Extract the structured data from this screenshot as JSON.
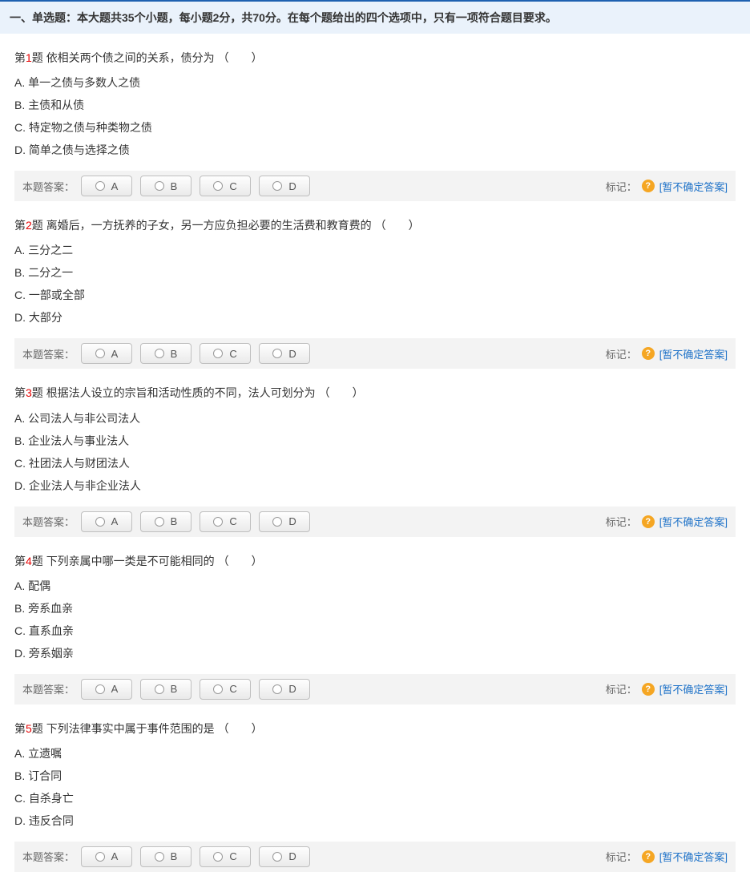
{
  "section_header": "一、单选题：本大题共35个小题，每小题2分，共70分。在每个题给出的四个选项中，只有一项符合题目要求。",
  "answer_label": "本题答案：",
  "mark_label": "标记：",
  "unsure_text": "[暂不确定答案]",
  "choices": [
    "A",
    "B",
    "C",
    "D"
  ],
  "questions": [
    {
      "num": "1",
      "prefix": "第",
      "suffix": "题",
      "stem": "依相关两个债之间的关系，债分为 （　　）",
      "options": [
        "A. 单一之债与多数人之债",
        "B. 主债和从债",
        "C. 特定物之债与种类物之债",
        "D. 简单之债与选择之债"
      ]
    },
    {
      "num": "2",
      "prefix": "第",
      "suffix": "题",
      "stem": "离婚后，一方抚养的子女，另一方应负担必要的生活费和教育费的 （　　）",
      "options": [
        "A. 三分之二",
        "B. 二分之一",
        "C. 一部或全部",
        "D. 大部分"
      ]
    },
    {
      "num": "3",
      "prefix": "第",
      "suffix": "题",
      "stem": "根据法人设立的宗旨和活动性质的不同，法人可划分为 （　　）",
      "options": [
        "A. 公司法人与非公司法人",
        "B. 企业法人与事业法人",
        "C. 社团法人与财团法人",
        "D. 企业法人与非企业法人"
      ]
    },
    {
      "num": "4",
      "prefix": "第",
      "suffix": "题",
      "stem": "下列亲属中哪一类是不可能相同的 （　　）",
      "options": [
        "A. 配偶",
        "B. 旁系血亲",
        "C. 直系血亲",
        "D. 旁系姻亲"
      ]
    },
    {
      "num": "5",
      "prefix": "第",
      "suffix": "题",
      "stem": "下列法律事实中属于事件范围的是 （　　）",
      "options": [
        "A. 立遗嘱",
        "B. 订合同",
        "C. 自杀身亡",
        "D. 违反合同"
      ]
    }
  ]
}
